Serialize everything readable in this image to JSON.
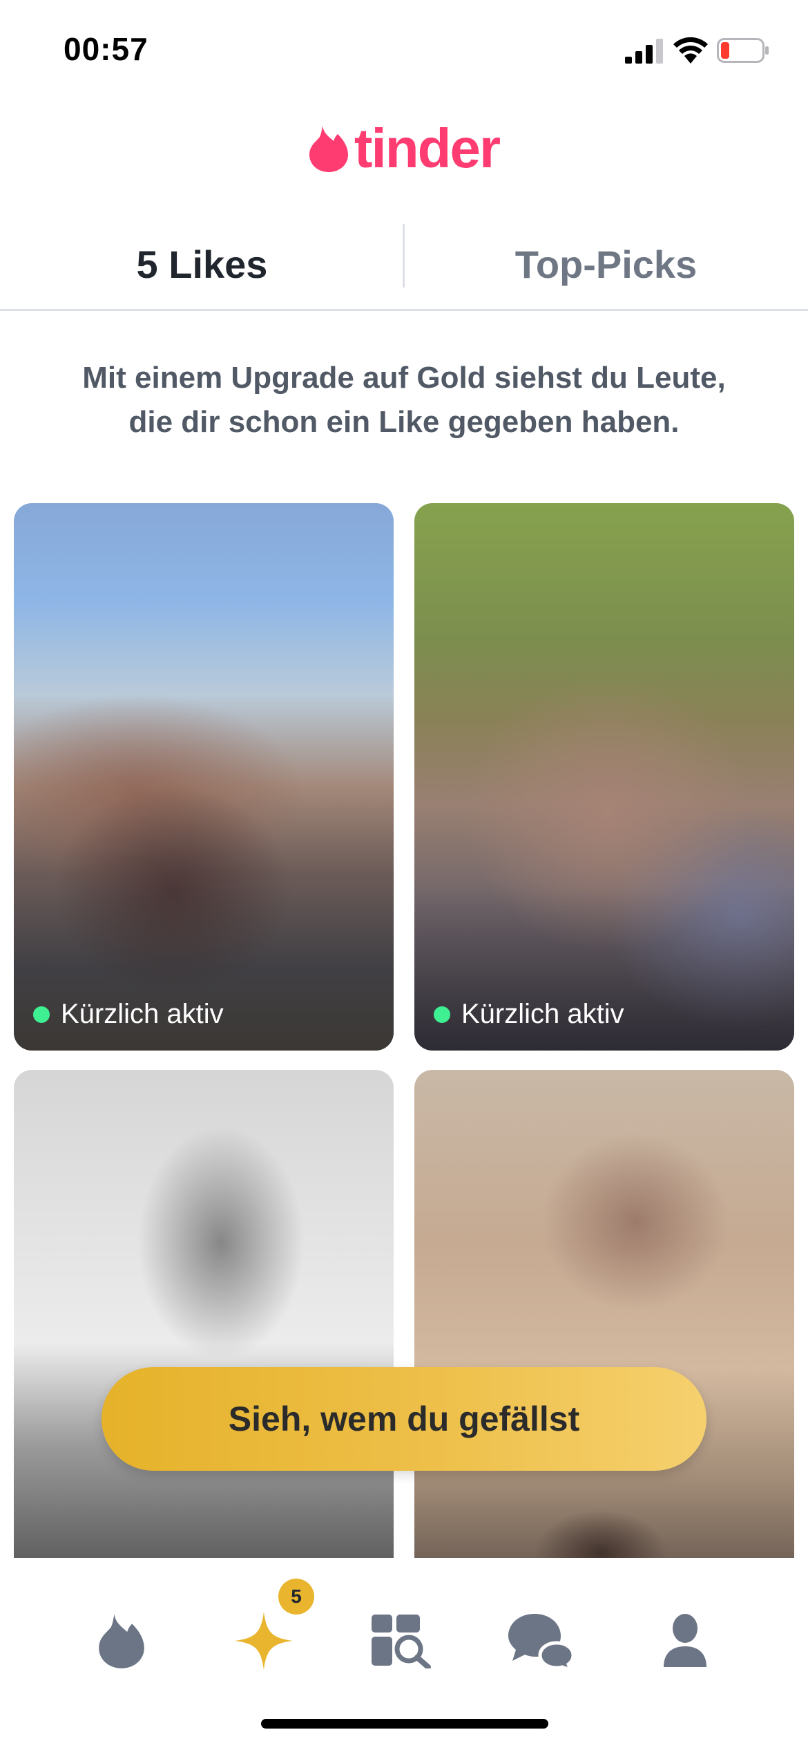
{
  "status_bar": {
    "time": "00:57",
    "signal_icon": "cellular-signal-icon",
    "wifi_icon": "wifi-icon",
    "battery_icon": "battery-low-icon",
    "battery_color": "#ff3b30"
  },
  "header": {
    "logo_text": "tinder",
    "logo_icon": "tinder-flame-icon",
    "brand_color": "#fe3c72"
  },
  "tabs": [
    {
      "label": "5 Likes",
      "active": true
    },
    {
      "label": "Top-Picks",
      "active": false
    }
  ],
  "upgrade": {
    "line1": "Mit einem Upgrade auf Gold siehst du Leute,",
    "line2": "die dir schon ein Like gegeben haben."
  },
  "cards": [
    {
      "status_label": "Kürzlich aktiv"
    },
    {
      "status_label": "Kürzlich aktiv"
    },
    {
      "status_label": ""
    },
    {
      "status_label": ""
    }
  ],
  "cta": {
    "label": "Sieh, wem du gefällst",
    "color": "#e9b52e"
  },
  "bottom_nav": {
    "items": [
      {
        "icon": "flame-icon",
        "name": "discover"
      },
      {
        "icon": "gold-star-icon",
        "name": "likes",
        "badge": "5"
      },
      {
        "icon": "explore-grid-icon",
        "name": "explore"
      },
      {
        "icon": "chat-bubbles-icon",
        "name": "messages"
      },
      {
        "icon": "profile-icon",
        "name": "profile"
      }
    ]
  }
}
